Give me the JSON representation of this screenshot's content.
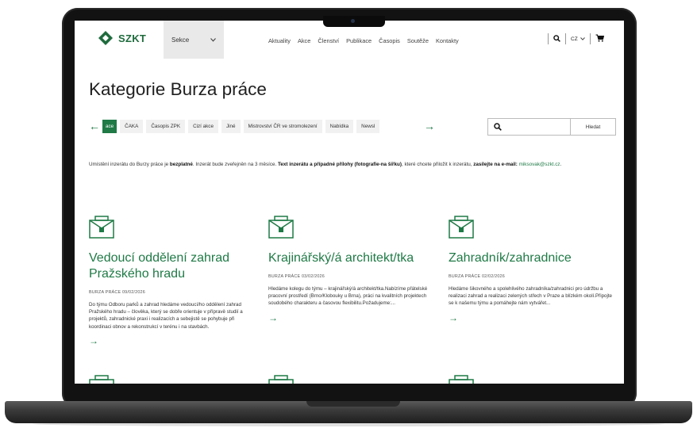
{
  "header": {
    "logo_text": "SZKT",
    "sekce_label": "Sekce",
    "nav": [
      "Aktuality",
      "Akce",
      "Členství",
      "Publikace",
      "Časopis",
      "Soutěže",
      "Kontakty"
    ],
    "lang": "CZ"
  },
  "page": {
    "title": "Kategorie Burza práce"
  },
  "categories": {
    "items": [
      "ace",
      "ČAKA",
      "Časopis ZPK",
      "Cizí akce",
      "Jiné",
      "Mistrovství ČR ve stromolezení",
      "Nabídka",
      "Newsl"
    ]
  },
  "search": {
    "placeholder": "",
    "button": "Hledat"
  },
  "info": {
    "p1": "Umístění inzerátu do Burzy práce je ",
    "b1": "bezplatné",
    "p2": ". Inzerát bude zveřejněn na 3 měsíce. ",
    "b2": "Text inzerátu a případné přílohy (fotografie-na šířku)",
    "p3": ", které chcete přiložit k inzerátu, ",
    "b3": "zasílejte na e-mail:",
    "email": " miksovak@szkt.cz",
    "p4": "."
  },
  "cards": [
    {
      "title": "Vedoucí oddělení zahrad Pražského hradu",
      "meta": "BURZA PRÁCE 09/02/2026",
      "text": "Do týmu Odboru parků a zahrad hledáme vedoucí/ho oddělení zahrad Pražského hradu – člověka, který se dobře orientuje v přípravě studií a projektů, zahradnické praxi i realizacích a sebejistě se pohybuje při koordinaci obnov a rekonstrukcí v terénu i na stavbách."
    },
    {
      "title": "Krajinářský/á architekt/tka",
      "meta": "BURZA PRÁCE 03/02/2026",
      "text": "Hledáme kolegu do týmu – krajinářský/á architekt/tka.Nabízíme přátelské pracovní prostředí (Brno/Klobouky u Brna), práci na kvalitních projektech soudobého charakteru a časovou flexibilitu.Požadujeme:..."
    },
    {
      "title": "Zahradník/zahradnice",
      "meta": "BURZA PRÁCE 02/02/2026",
      "text": "Hledáme šikovného a spolehlivého zahradníka/zahradnici pro údržbu a realizaci zahrad a realizaci zelených střech v Praze a blízkém okolí.Připojte se k našemu týmu a pomáhejte nám vytvářet..."
    }
  ],
  "colors": {
    "brand_green": "#1f7a46",
    "frame": "#121212"
  }
}
